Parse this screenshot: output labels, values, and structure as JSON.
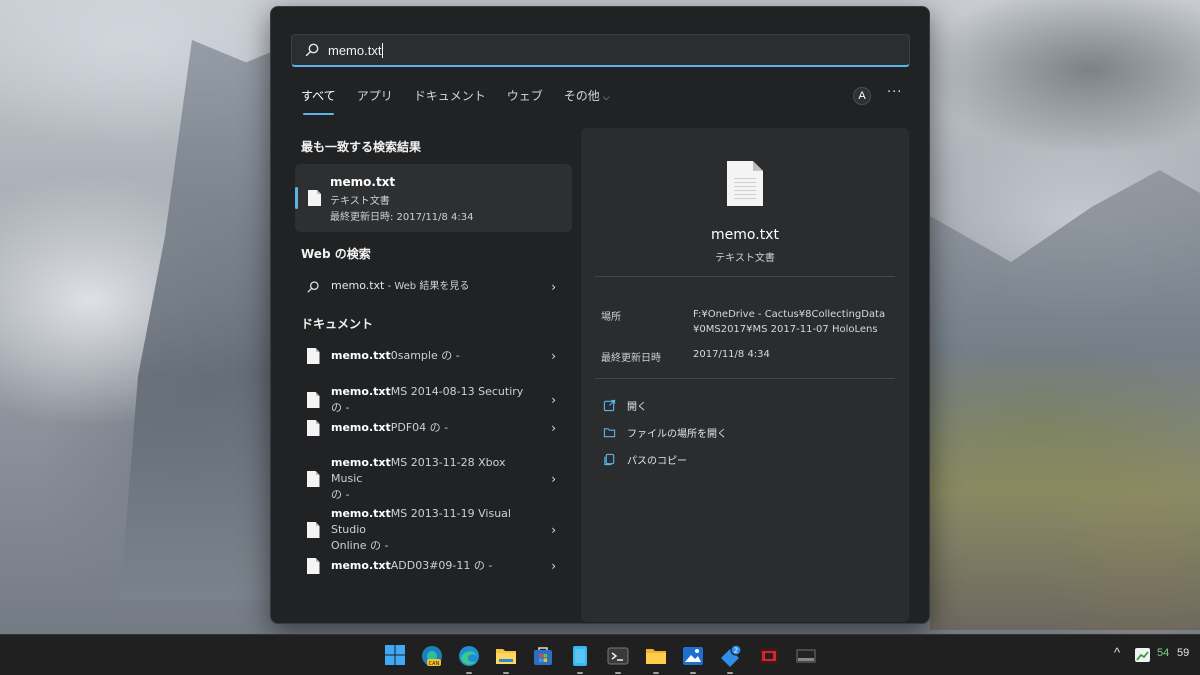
{
  "search": {
    "query": "memo.txt"
  },
  "tabs": [
    {
      "label": "すべて",
      "active": true
    },
    {
      "label": "アプリ"
    },
    {
      "label": "ドキュメント"
    },
    {
      "label": "ウェブ"
    },
    {
      "label": "その他",
      "dropdown": true
    }
  ],
  "header_buttons": {
    "account_initial": "A",
    "more": "···"
  },
  "best_match": {
    "heading": "最も一致する検索結果",
    "title": "memo.txt",
    "type": "テキスト文書",
    "modified": "最終更新日時: 2017/11/8 4:34"
  },
  "web_search": {
    "heading": "Web の検索",
    "query": "memo.txt",
    "suffix": " - Web 結果を見る"
  },
  "documents": {
    "heading": "ドキュメント",
    "items": [
      {
        "name": "memo.txt",
        "rest": "0sample の -",
        "rest2": ""
      },
      {
        "name": "memo.txt",
        "rest": "MS 2014-08-13 Secutiry の -",
        "rest2": ""
      },
      {
        "name": "memo.txt",
        "rest": "PDF04 の -",
        "rest2": ""
      },
      {
        "name": "memo.txt",
        "rest": "MS 2013-11-28 Xbox Music",
        "rest2": "の -"
      },
      {
        "name": "memo.txt",
        "rest": "MS 2013-11-19 Visual Studio",
        "rest2": "Online の -"
      },
      {
        "name": "memo.txt",
        "rest": "ADD03#09-11 の -",
        "rest2": ""
      }
    ]
  },
  "detail": {
    "name": "memo.txt",
    "type": "テキスト文書",
    "location_label": "場所",
    "location_value": "F:¥OneDrive - Cactus¥8CollectingData¥0MS2017¥MS 2017-11-07 HoloLens",
    "modified_label": "最終更新日時",
    "modified_value": "2017/11/8 4:34",
    "actions": [
      {
        "label": "開く",
        "icon": "open-external-icon"
      },
      {
        "label": "ファイルの場所を開く",
        "icon": "folder-icon"
      },
      {
        "label": "パスのコピー",
        "icon": "copy-icon"
      }
    ]
  },
  "taskbar": {
    "icons": [
      "windows-start-icon",
      "edge-canary-icon",
      "edge-icon",
      "file-explorer-icon",
      "store-icon",
      "notepad-icon",
      "terminal-icon",
      "folder-icon",
      "photos-icon",
      "feedback-hub-icon",
      "app-red-icon",
      "app-dark-icon"
    ],
    "badge_count": "2",
    "tray_value_1": "54",
    "tray_value_2": "59",
    "colors": {
      "accent": "#5ab4e6",
      "green": "#7ed38b"
    }
  }
}
